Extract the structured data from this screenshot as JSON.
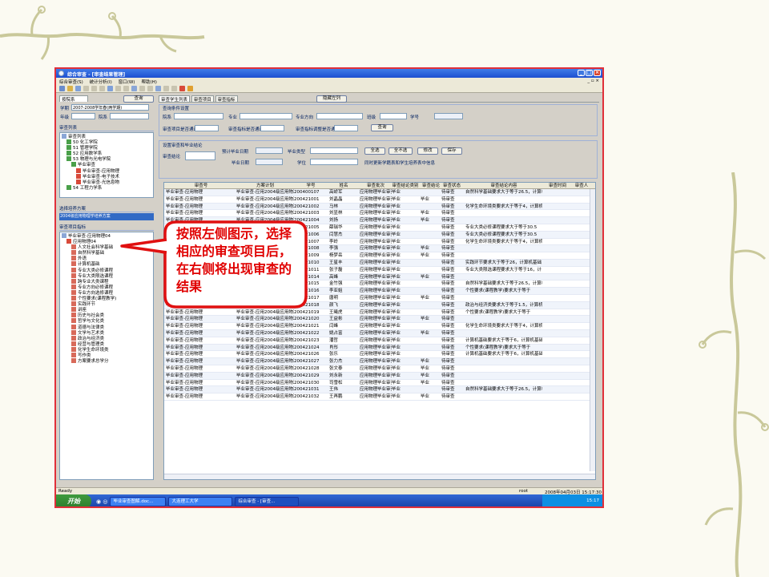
{
  "window": {
    "title": "综合审查 - [审查结果管理]",
    "buttons": [
      "_",
      "□",
      "×"
    ]
  },
  "menubar": {
    "items": [
      "综合审查(S)",
      "统计分析(I)",
      "窗口(W)",
      "帮助(H)"
    ],
    "right": "_ ▫ ×"
  },
  "left": {
    "school_label": "按院系",
    "query_button": "查询",
    "term_label": "学期",
    "term_value": "2007-2008学年春(两学期)",
    "grade_label": "年级",
    "dept_label": "院系",
    "review_list_title": "审查列表",
    "tree": [
      {
        "label": "审查列表",
        "indent": 0,
        "icon": "folder"
      },
      {
        "label": "50 化工学院",
        "indent": 1,
        "icon": "plus"
      },
      {
        "label": "51 管理学院",
        "indent": 1,
        "icon": "plus"
      },
      {
        "label": "52 应用数学系",
        "indent": 1,
        "icon": "plus"
      },
      {
        "label": "53 物理与光电学院",
        "indent": 1,
        "icon": "minus"
      },
      {
        "label": "毕业审查",
        "indent": 2,
        "icon": "minus"
      },
      {
        "label": "毕业审查-应用物理",
        "indent": 3,
        "icon": "check"
      },
      {
        "label": "毕业审查-电子技术",
        "indent": 3,
        "icon": "doc"
      },
      {
        "label": "毕业审查-光信息物",
        "indent": 3,
        "icon": "doc"
      },
      {
        "label": "54 工程力学系",
        "indent": 1,
        "icon": "plus"
      }
    ],
    "plan_title": "选择培养方案",
    "plan_value": "2004级应用物理学培养方案",
    "items_title": "审查项目指标",
    "items_root": "毕业审查-应用物理04",
    "items_sub": "应用物理04",
    "items": [
      "人文社会科学基础",
      "自然科学基础",
      "外语",
      "计算机基础",
      "专业大类必修课程",
      "专业大类限选课程",
      "跨专业大类课程",
      "专业方向必修课程",
      "专业方向选修课程",
      "个性要求(课程教学)",
      "实践环节",
      "讲座",
      "历史与社会类",
      "哲学与文化类",
      "道德与法律类",
      "文学与艺术类",
      "政治与经济类",
      "经营与管理类",
      "化学生命环境类",
      "写作类",
      "方案要求总学分"
    ]
  },
  "right": {
    "tabs": [
      "审查学生列表",
      "审查项目",
      "审查指标"
    ],
    "hide_left": "隐藏左列",
    "cond_title": "查询条件设置",
    "cond": {
      "dept": "院系",
      "major": "专业",
      "direction": "专业方向",
      "class": "班级",
      "stuno": "学号",
      "item_pass": "审查项目是否通过",
      "index_pass": "审查指标是否通过",
      "index_adjust": "审查指标调整是否通过",
      "query": "查询"
    },
    "conclusion_title": "设置审查和毕业结论",
    "conclusion": {
      "review": "审查结论",
      "exp_date": "预计毕业日期",
      "grad_date": "毕业日期",
      "grad_type": "毕业类型",
      "degree": "学位",
      "btn_all": "全选",
      "btn_none": "全不选",
      "btn_edit": "修改",
      "btn_save": "保存",
      "note": "同时更新学籍表和学生培养表中信息"
    }
  },
  "grid": {
    "columns": [
      "审查号",
      "方案计划",
      "学号",
      "姓名",
      "审查批次",
      "审查结论类别",
      "审查结论",
      "审查状态",
      "审查结论内容",
      "审查时间",
      "审查人"
    ],
    "rows": [
      {
        "n": "毕业审查-应用物理",
        "p": "毕业审查-应用2004级应用物理学培养方案",
        "s": "200400107",
        "name": "高峤军",
        "b": "应用物理毕业审查",
        "t": "毕业",
        "c": "",
        "st": "待审查",
        "ct": "自然科学基础要求大于等于26.5，计算机"
      },
      {
        "n": "毕业审查-应用物理",
        "p": "毕业审查-应用2004级应用物理学培养方案",
        "s": "200421001",
        "name": "刘晶晶",
        "b": "应用物理毕业审查",
        "t": "毕业",
        "c": "毕业",
        "st": "待审查",
        "ct": ""
      },
      {
        "n": "毕业审查-应用物理",
        "p": "毕业审查-应用2004级应用物理学培养方案",
        "s": "200421002",
        "name": "马林",
        "b": "应用物理毕业审查",
        "t": "毕业",
        "c": "",
        "st": "待审查",
        "ct": "化学生命环境类要求大于等于4，计算机"
      },
      {
        "n": "毕业审查-应用物理",
        "p": "毕业审查-应用2004级应用物理学培养方案",
        "s": "200421003",
        "name": "刘显林",
        "b": "应用物理毕业审查",
        "t": "毕业",
        "c": "毕业",
        "st": "待审查",
        "ct": ""
      },
      {
        "n": "毕业审查-应用物理",
        "p": "毕业审查-应用2004级应用物理学培养方案",
        "s": "200421004",
        "name": "刘扬",
        "b": "应用物理毕业审查",
        "t": "毕业",
        "c": "毕业",
        "st": "待审查",
        "ct": ""
      },
      {
        "n": "毕业审查-应用物理",
        "p": "毕业审查-应用2004级应用物理学培养方案",
        "s": "200421005",
        "name": "薛瑞华",
        "b": "应用物理毕业审查",
        "t": "毕业",
        "c": "",
        "st": "待审查",
        "ct": "专业大类必修课程要求大于等于30.5"
      },
      {
        "n": "毕业审查-应用物理",
        "p": "毕业审查-应用2004级应用物理学培养方案",
        "s": "200421006",
        "name": "闫慧杰",
        "b": "应用物理毕业审查",
        "t": "毕业",
        "c": "",
        "st": "待审查",
        "ct": "专业大类必修课程要求大于等于30.5"
      },
      {
        "n": "毕业审查-应用物理",
        "p": "毕业审查-应用2004级应用物理学培养方案",
        "s": "200421007",
        "name": "李岭",
        "b": "应用物理毕业审查",
        "t": "毕业",
        "c": "",
        "st": "待审查",
        "ct": "化学生命环境类要求大于等于4，计算机"
      },
      {
        "n": "毕业审查-应用物理",
        "p": "毕业审查-应用2004级应用物理学培养方案",
        "s": "200421008",
        "name": "李强",
        "b": "应用物理毕业审查",
        "t": "毕业",
        "c": "毕业",
        "st": "待审查",
        "ct": ""
      },
      {
        "n": "毕业审查-应用物理",
        "p": "毕业审查-应用2004级应用物理学培养方案",
        "s": "200421009",
        "name": "杨梦岳",
        "b": "应用物理毕业审查",
        "t": "毕业",
        "c": "毕业",
        "st": "待审查",
        "ct": ""
      },
      {
        "n": "毕业审查-应用物理",
        "p": "毕业审查-应用2004级应用物理学培养方案",
        "s": "200421010",
        "name": "王星丰",
        "b": "应用物理毕业审查",
        "t": "毕业",
        "c": "",
        "st": "待审查",
        "ct": "实践环节要求大于等于26，计算机基础"
      },
      {
        "n": "毕业审查-应用物理",
        "p": "毕业审查-应用2004级应用物理学培养方案",
        "s": "200421011",
        "name": "张子磊",
        "b": "应用物理毕业审查",
        "t": "毕业",
        "c": "",
        "st": "待审查",
        "ct": "专业大类限选课程要求大于等于16，计"
      },
      {
        "n": "毕业审查-应用物理",
        "p": "毕业审查-应用2004级应用物理学培养方案",
        "s": "200421014",
        "name": "高峰",
        "b": "应用物理毕业审查",
        "t": "毕业",
        "c": "毕业",
        "st": "待审查",
        "ct": ""
      },
      {
        "n": "毕业审查-应用物理",
        "p": "毕业审查-应用2004级应用物理学培养方案",
        "s": "200421015",
        "name": "金竹强",
        "b": "应用物理毕业审查",
        "t": "毕业",
        "c": "",
        "st": "待审查",
        "ct": "自然科学基础要求大于等于26.5，计算机"
      },
      {
        "n": "毕业审查-应用物理",
        "p": "毕业审查-应用2004级应用物理学培养方案",
        "s": "200421016",
        "name": "李亚姐",
        "b": "应用物理毕业审查",
        "t": "毕业",
        "c": "",
        "st": "待审查",
        "ct": "个性要求(课程教学)要求大于等于"
      },
      {
        "n": "毕业审查-应用物理",
        "p": "毕业审查-应用2004级应用物理学培养方案",
        "s": "200421017",
        "name": "唐明",
        "b": "应用物理毕业审查",
        "t": "毕业",
        "c": "毕业",
        "st": "待审查",
        "ct": ""
      },
      {
        "n": "毕业审查-应用物理",
        "p": "毕业审查-应用2004级应用物理学培养方案",
        "s": "200421018",
        "name": "颜飞",
        "b": "应用物理毕业审查",
        "t": "毕业",
        "c": "",
        "st": "待审查",
        "ct": "政治与经济类要求大于等于1.5，计算机"
      },
      {
        "n": "毕业审查-应用物理",
        "p": "毕业审查-应用2004级应用物理学培养方案",
        "s": "200421019",
        "name": "王曦虎",
        "b": "应用物理毕业审查",
        "t": "毕业",
        "c": "",
        "st": "待审查",
        "ct": "个性要求(课程教学)要求大于等于"
      },
      {
        "n": "毕业审查-应用物理",
        "p": "毕业审查-应用2004级应用物理学培养方案",
        "s": "200421020",
        "name": "王益彬",
        "b": "应用物理毕业审查",
        "t": "毕业",
        "c": "毕业",
        "st": "待审查",
        "ct": ""
      },
      {
        "n": "毕业审查-应用物理",
        "p": "毕业审查-应用2004级应用物理学培养方案",
        "s": "200421021",
        "name": "闫峰",
        "b": "应用物理毕业审查",
        "t": "毕业",
        "c": "",
        "st": "待审查",
        "ct": "化学生命环境类要求大于等于4，计算机"
      },
      {
        "n": "毕业审查-应用物理",
        "p": "毕业审查-应用2004级应用物理学培养方案",
        "s": "200421022",
        "name": "姚占富",
        "b": "应用物理毕业审查",
        "t": "毕业",
        "c": "毕业",
        "st": "待审查",
        "ct": ""
      },
      {
        "n": "毕业审查-应用物理",
        "p": "毕业审查-应用2004级应用物理学培养方案",
        "s": "200421023",
        "name": "潘哲",
        "b": "应用物理毕业审查",
        "t": "毕业",
        "c": "",
        "st": "待审查",
        "ct": "计算机基础要求大于等于6，计算机基础"
      },
      {
        "n": "毕业审查-应用物理",
        "p": "毕业审查-应用2004级应用物理学培养方案",
        "s": "200421024",
        "name": "肖彤",
        "b": "应用物理毕业审查",
        "t": "毕业",
        "c": "",
        "st": "待审查",
        "ct": "个性要求(课程教学)要求大于等于"
      },
      {
        "n": "毕业审查-应用物理",
        "p": "毕业审查-应用2004级应用物理学培养方案",
        "s": "200421026",
        "name": "张乐",
        "b": "应用物理毕业审查",
        "t": "毕业",
        "c": "",
        "st": "待审查",
        "ct": "计算机基础要求大于等于6，计算机基础"
      },
      {
        "n": "毕业审查-应用物理",
        "p": "毕业审查-应用2004级应用物理学培养方案",
        "s": "200421027",
        "name": "张力杰",
        "b": "应用物理毕业审查",
        "t": "毕业",
        "c": "毕业",
        "st": "待审查",
        "ct": ""
      },
      {
        "n": "毕业审查-应用物理",
        "p": "毕业审查-应用2004级应用物理学培养方案",
        "s": "200421028",
        "name": "张文泰",
        "b": "应用物理毕业审查",
        "t": "毕业",
        "c": "毕业",
        "st": "待审查",
        "ct": ""
      },
      {
        "n": "毕业审查-应用物理",
        "p": "毕业审查-应用2004级应用物理学培养方案",
        "s": "200421029",
        "name": "刘永新",
        "b": "应用物理毕业审查",
        "t": "毕业",
        "c": "毕业",
        "st": "待审查",
        "ct": ""
      },
      {
        "n": "毕业审查-应用物理",
        "p": "毕业审查-应用2004级应用物理学培养方案",
        "s": "200421030",
        "name": "司雪松",
        "b": "应用物理毕业审查",
        "t": "毕业",
        "c": "毕业",
        "st": "待审查",
        "ct": ""
      },
      {
        "n": "毕业审查-应用物理",
        "p": "毕业审查-应用2004级应用物理学培养方案",
        "s": "200421031",
        "name": "王伟",
        "b": "应用物理毕业审查",
        "t": "毕业",
        "c": "",
        "st": "待审查",
        "ct": "自然科学基础要求大于等于26.5，计算机"
      },
      {
        "n": "毕业审查-应用物理",
        "p": "毕业审查-应用2004级应用物理学培养方案",
        "s": "200421032",
        "name": "王再鹏",
        "b": "应用物理毕业审查",
        "t": "毕业",
        "c": "毕业",
        "st": "待审查",
        "ct": ""
      }
    ]
  },
  "status": {
    "ready": "Ready",
    "user": "root",
    "datetime": "2008年04月03日 15:17:30"
  },
  "taskbar": {
    "start": "开始",
    "tasks": [
      "毕业审查图解.doc...",
      "大连理工大学",
      "综合审查 - [审查..."
    ],
    "clock": "15:17"
  },
  "callout": {
    "text": "按照左侧图示，选择相应的审查项目后，在右侧将出现审查的结果"
  }
}
